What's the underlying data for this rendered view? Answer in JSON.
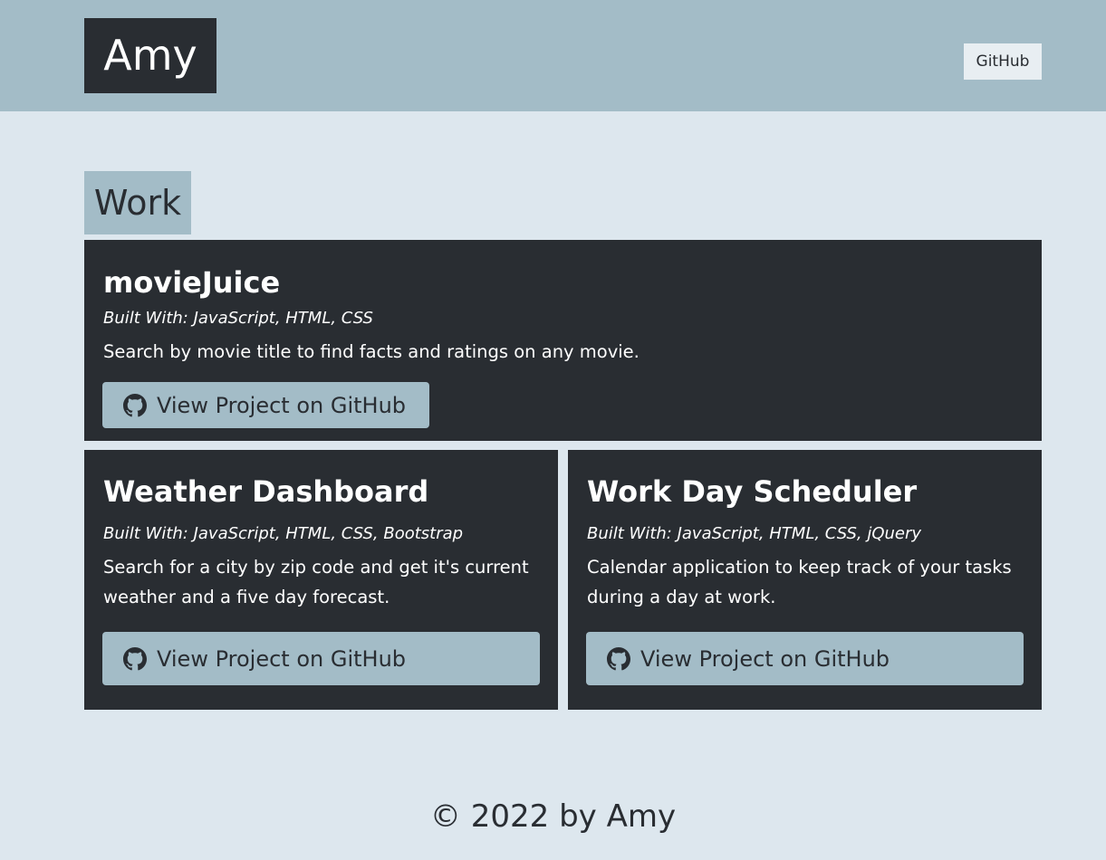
{
  "header": {
    "brand": "Amy",
    "nav_link": "GitHub"
  },
  "section": {
    "title": "Work"
  },
  "projects": [
    {
      "title": "movieJuice",
      "built_with": "Built With: JavaScript, HTML, CSS",
      "description": "Search by movie title to find facts and ratings on any movie.",
      "button_label": "View Project on GitHub",
      "button_icon": "github-icon"
    },
    {
      "title": "Weather Dashboard",
      "built_with": "Built With: JavaScript, HTML, CSS, Bootstrap",
      "description": "Search for a city by zip code and get it's current weather and a five day forecast.",
      "button_label": "View Project on GitHub",
      "button_icon": "github-icon"
    },
    {
      "title": "Work Day Scheduler",
      "built_with": "Built With: JavaScript, HTML, CSS, jQuery",
      "description": "Calendar application to keep track of your tasks during a day at work.",
      "button_label": "View Project on GitHub",
      "button_icon": "github-icon"
    }
  ],
  "footer": {
    "text": "© 2022 by Amy"
  },
  "colors": {
    "page_background": "#dde7ee",
    "header_background": "#a3bcc7",
    "dark": "#292d32",
    "accent": "#a3bcc7"
  }
}
